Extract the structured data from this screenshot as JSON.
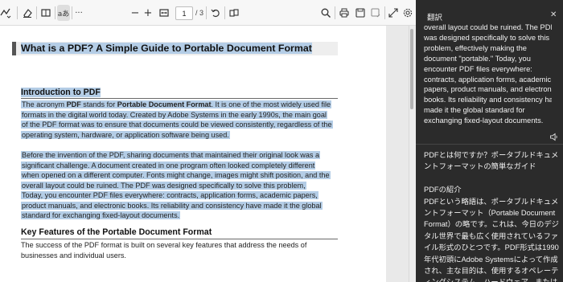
{
  "toolbar": {
    "page_current": "1",
    "page_total": "/ 3",
    "read_aloud_label": "aあ",
    "more_label": "···",
    "zoom_out_label": "−",
    "zoom_in_label": "+"
  },
  "document": {
    "title": "What is a PDF? A Simple Guide to Portable Document Format",
    "sections": [
      {
        "heading": "Introduction to PDF",
        "paragraphs": [
          {
            "lines": [
              [
                "The acronym ",
                "PDF",
                " stands for ",
                "Portable Document Format",
                ". It is one of the most widely used file"
              ],
              [
                "formats in the digital world today. Created by Adobe Systems in the early 1990s, the main goal"
              ],
              [
                "of the PDF format was to ensure that documents could be viewed consistently, regardless of the"
              ],
              [
                "operating system, hardware, or application software being used."
              ]
            ]
          },
          {
            "lines": [
              [
                "Before the invention of the PDF, sharing documents that maintained their original look was a"
              ],
              [
                "significant challenge. A document created in one program often looked completely different"
              ],
              [
                "when opened on a different computer. Fonts might change, images might shift position, and the"
              ],
              [
                "overall layout could be ruined. The PDF was designed specifically to solve this problem,"
              ],
              [
                "effectively making the document \"portable.\""
              ]
            ]
          },
          {
            "lines": [
              [
                "Today, you encounter PDF files everywhere: contracts, application forms, academic papers,"
              ],
              [
                "product manuals, and electronic books. Its reliability and consistency have made it the global"
              ],
              [
                "standard for exchanging fixed-layout documents."
              ]
            ]
          }
        ]
      },
      {
        "heading": "Key Features of the Portable Document Format",
        "paragraphs": [
          {
            "lines": [
              [
                "The success of the PDF format is built on several key features that address the needs of"
              ],
              [
                "businesses and individual users."
              ]
            ]
          }
        ]
      }
    ]
  },
  "panel": {
    "title": "翻訳",
    "close_label": "✕",
    "source_lines": [
      "overall layout could be ruined. The PDF",
      "was designed specifically to solve this",
      "problem, effectively making the",
      "document \"portable.\" Today, you",
      "encounter PDF files everywhere:",
      "contracts, application forms, academic",
      "papers, product manuals, and electronic",
      "books. Its reliability and consistency have",
      "made it the global standard for",
      "exchanging fixed-layout documents."
    ],
    "translation_lines": [
      "PDFとは何ですか？ポータブルドキュメ",
      "ントフォーマットの簡単なガイド",
      "",
      "PDFの紹介",
      "PDFという略語は、ポータブルドキュメ",
      "ントフォーマット（Portable Document",
      "Format）の略です。これは、今日のデジ",
      "タル世界で最も広く使用されているファ",
      "イル形式のひとつです。PDF形式は1990",
      "年代初頭にAdobe Systemsによって作成",
      "され、主な目的は、使用するオペレーテ",
      "ィングシステム、ハードウェア、または"
    ]
  },
  "colors": {
    "selection": "#b4cde6",
    "panel_bg": "#2b2b2b",
    "toolbar_bg": "#f7f7f7"
  }
}
